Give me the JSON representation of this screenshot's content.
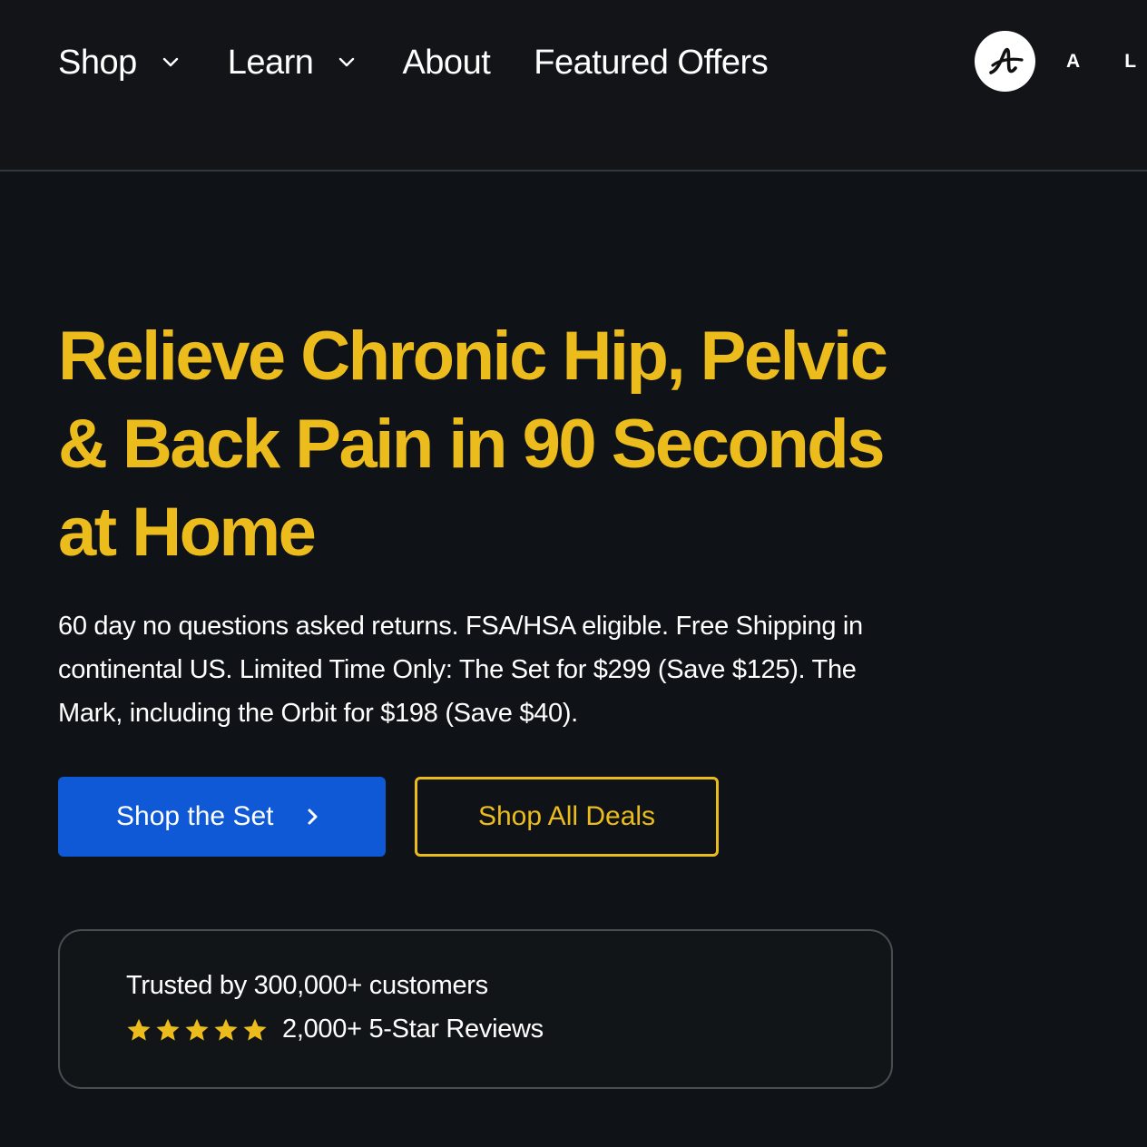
{
  "nav": {
    "items": [
      {
        "label": "Shop",
        "has_dropdown": true
      },
      {
        "label": "Learn",
        "has_dropdown": true
      },
      {
        "label": "About",
        "has_dropdown": false
      },
      {
        "label": "Featured Offers",
        "has_dropdown": false
      }
    ],
    "logo_text": "A L E"
  },
  "hero": {
    "title": "Relieve Chronic Hip, Pelvic & Back Pain in 90 Seconds at Home",
    "subtitle": "60 day no questions asked returns. FSA/HSA eligible. Free Shipping in continental US. Limited Time Only: The Set for $299 (Save $125). The Mark, including the Orbit for $198 (Save $40).",
    "primary_button": "Shop the Set",
    "secondary_button": "Shop All Deals"
  },
  "trust": {
    "customers": "Trusted by 300,000+ customers",
    "rating_stars": 5,
    "reviews": "2,000+ 5-Star Reviews"
  },
  "colors": {
    "background": "#0f1318",
    "header_background": "#131417",
    "accent_yellow": "#ecbc1c",
    "primary_blue": "#0f58d6",
    "text": "#ffffff"
  }
}
